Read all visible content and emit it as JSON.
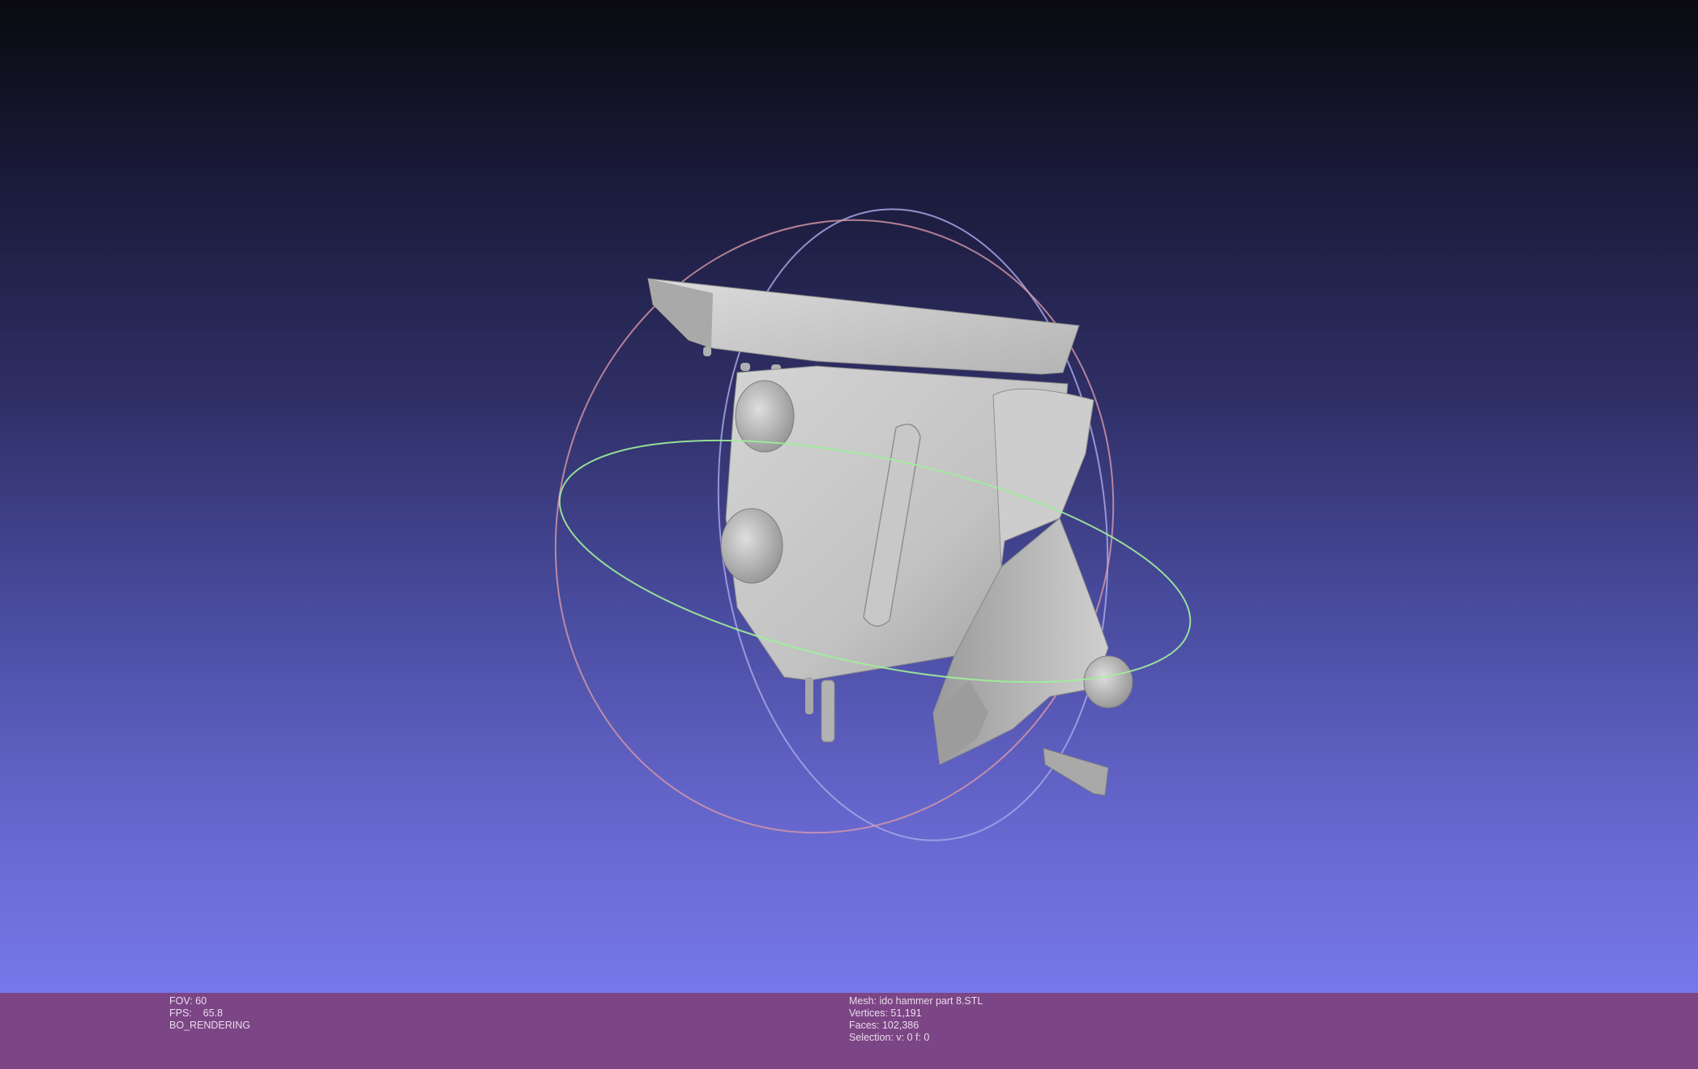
{
  "viewport": {
    "background_top": "#0a0a10",
    "background_bottom": "#7778ea",
    "model": "mesh-render",
    "trackball": {
      "ring_x_color": "#e8a0a8",
      "ring_y_color": "#9ef09a",
      "ring_z_color": "#b0b0f0"
    }
  },
  "info_left": {
    "fov": "FOV: 60",
    "fps": "FPS:    65.8",
    "mode": "BO_RENDERING"
  },
  "info_right": {
    "mesh": "Mesh: ido hammer part 8.STL",
    "vertices": "Vertices: 51,191",
    "faces": "Faces: 102,386",
    "selection": "Selection: v: 0 f: 0"
  },
  "colors": {
    "info_bar": "#7c4585",
    "info_text": "#e9dcec",
    "mesh": "#bdbdbd"
  }
}
